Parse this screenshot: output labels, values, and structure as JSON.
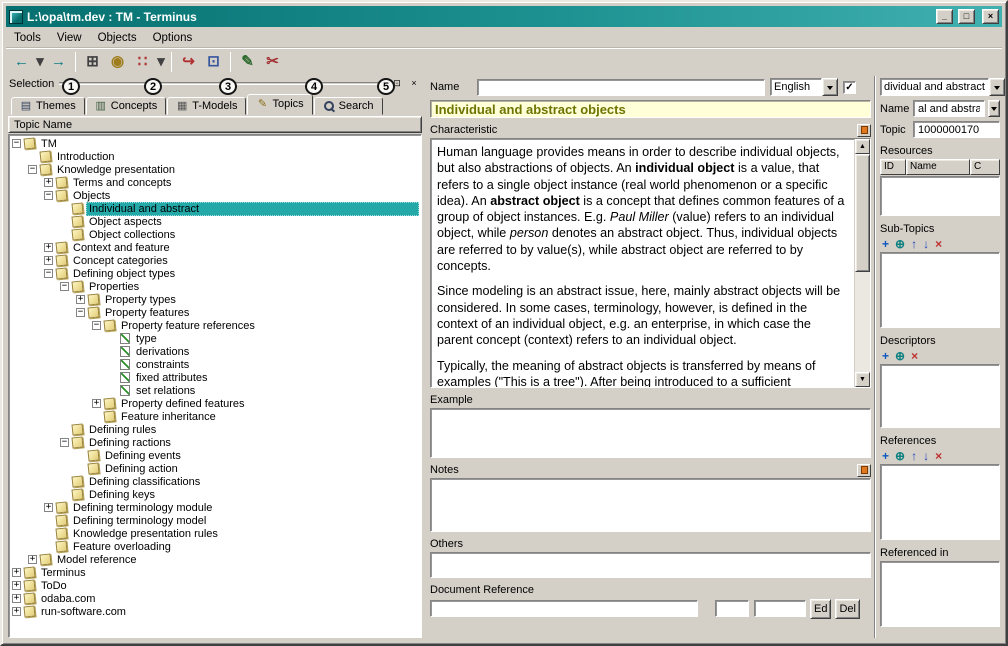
{
  "window": {
    "title": "L:\\opa\\tm.dev : TM - Terminus",
    "controls": [
      {
        "name": "minimize-button",
        "glyph": "_"
      },
      {
        "name": "maximize-button",
        "glyph": "□"
      },
      {
        "name": "close-button",
        "glyph": "×"
      }
    ]
  },
  "colors": {
    "titlebar_teal": "#0a8080",
    "chrome_gray": "#d4d0c8",
    "selection_highlight": "#25a8a8",
    "topic_title_text": "#6e7400",
    "topic_title_bg": "#ffffd8"
  },
  "menu": {
    "items": [
      "Tools",
      "View",
      "Objects",
      "Options"
    ]
  },
  "toolbar": {
    "buttons": [
      {
        "name": "back-button",
        "icon": "back-arrow-icon",
        "glyph": "←",
        "color": "#0e7d86"
      },
      {
        "name": "back-history-button",
        "icon": "chevron-down-icon",
        "glyph": "▾",
        "color": "#404040",
        "narrow": true
      },
      {
        "name": "forward-button",
        "icon": "forward-arrow-icon",
        "glyph": "→",
        "color": "#0e7d86"
      },
      {
        "sep": true
      },
      {
        "name": "hierarchy-view-button",
        "icon": "hierarchy-icon",
        "glyph": "⊞",
        "color": "#404040"
      },
      {
        "name": "theme-view-button",
        "icon": "sphere-icon",
        "glyph": "◉",
        "color": "#a07d1c"
      },
      {
        "name": "new-topic-button",
        "icon": "new-topic-icon",
        "glyph": "∷",
        "color": "#b03434"
      },
      {
        "name": "new-topic-menu-button",
        "icon": "chevron-down-icon",
        "glyph": "▾",
        "color": "#404040",
        "narrow": true
      },
      {
        "sep": true
      },
      {
        "name": "check-out-button",
        "icon": "export-icon",
        "glyph": "↪",
        "color": "#b03030"
      },
      {
        "name": "copy-button",
        "icon": "copy-icon",
        "glyph": "⊡",
        "color": "#35569d"
      },
      {
        "sep": true
      },
      {
        "name": "edit-properties-button",
        "icon": "edit-list-icon",
        "glyph": "✎",
        "color": "#2f6b2f"
      },
      {
        "name": "unlink-button",
        "icon": "cut-icon",
        "glyph": "✂",
        "color": "#a33333"
      }
    ]
  },
  "selection_panel": {
    "caption": "Selection",
    "caption_buttons": [
      {
        "name": "dock-panel-button",
        "glyph": "⊡"
      },
      {
        "name": "close-panel-button",
        "glyph": "×"
      }
    ],
    "annotations": [
      "1",
      "2",
      "3",
      "4",
      "5"
    ],
    "tabs": [
      {
        "label": "Themes",
        "icon": "themes"
      },
      {
        "label": "Concepts",
        "icon": "concepts"
      },
      {
        "label": "T-Models",
        "icon": "tmodels"
      },
      {
        "label": "Topics",
        "icon": "topics",
        "active": true
      },
      {
        "label": "Search",
        "icon": "search"
      }
    ],
    "tree_header": "Topic Name",
    "tree": [
      {
        "label": "TM",
        "depth": 0,
        "expand": "-"
      },
      {
        "label": "Introduction",
        "depth": 1
      },
      {
        "label": "Knowledge presentation",
        "depth": 1,
        "expand": "-"
      },
      {
        "label": "Terms and concepts",
        "depth": 2,
        "expand": "+"
      },
      {
        "label": "Objects",
        "depth": 2,
        "expand": "-"
      },
      {
        "label": "Individual and abstract",
        "depth": 3,
        "selected": true
      },
      {
        "label": "Object aspects",
        "depth": 3
      },
      {
        "label": "Object collections",
        "depth": 3
      },
      {
        "label": "Context and feature",
        "depth": 2,
        "expand": "+"
      },
      {
        "label": "Concept categories",
        "depth": 2,
        "expand": "+"
      },
      {
        "label": "Defining object types",
        "depth": 2,
        "expand": "-"
      },
      {
        "label": "Properties",
        "depth": 3,
        "expand": "-"
      },
      {
        "label": "Property types",
        "depth": 4,
        "expand": "+"
      },
      {
        "label": "Property features",
        "depth": 4,
        "expand": "-"
      },
      {
        "label": "Property feature references",
        "depth": 5,
        "expand": "-"
      },
      {
        "label": "type",
        "depth": 6,
        "icon": "leaf"
      },
      {
        "label": "derivations",
        "depth": 6,
        "icon": "leaf"
      },
      {
        "label": "constraints",
        "depth": 6,
        "icon": "leaf"
      },
      {
        "label": "fixed attributes",
        "depth": 6,
        "icon": "leaf"
      },
      {
        "label": "set relations",
        "depth": 6,
        "icon": "leaf"
      },
      {
        "label": "Property defined features",
        "depth": 5,
        "expand": "+"
      },
      {
        "label": "Feature inheritance",
        "depth": 5
      },
      {
        "label": "Defining rules",
        "depth": 3
      },
      {
        "label": "Defining ractions",
        "depth": 3,
        "expand": "-"
      },
      {
        "label": "Defining events",
        "depth": 4
      },
      {
        "label": "Defining action",
        "depth": 4
      },
      {
        "label": "Defining classifications",
        "depth": 3
      },
      {
        "label": "Defining keys",
        "depth": 3
      },
      {
        "label": "Defining terminology module",
        "depth": 2,
        "expand": "+"
      },
      {
        "label": "Defining terminology model",
        "depth": 2
      },
      {
        "label": "Knowledge presentation rules",
        "depth": 2
      },
      {
        "label": "Feature overloading",
        "depth": 2
      },
      {
        "label": "Model reference",
        "depth": 1,
        "expand": "+"
      },
      {
        "label": "Terminus",
        "depth": 0,
        "expand": "+"
      },
      {
        "label": "ToDo",
        "depth": 0,
        "expand": "+"
      },
      {
        "label": "odaba.com",
        "depth": 0,
        "expand": "+"
      },
      {
        "label": "run-software.com",
        "depth": 0,
        "expand": "+"
      }
    ]
  },
  "editor": {
    "name_label": "Name",
    "name_value": "",
    "language_value": "English",
    "language_check_glyph": "✓",
    "title": "Individual and abstract objects",
    "sections": {
      "characteristic_label": "Characteristic",
      "example_label": "Example",
      "notes_label": "Notes",
      "others_label": "Others",
      "docref_label": "Document Reference"
    },
    "scrollbar": {
      "up": "▲",
      "down": "▼"
    },
    "characteristic_paragraphs": [
      [
        {
          "t": "Human language provides means in order to describe individual objects, but also abstractions of objects. An "
        },
        {
          "t": "individual object",
          "b": true
        },
        {
          "t": " is a value, that refers to a single object instance (real world phenomenon or a specific idea). An "
        },
        {
          "t": "abstract object",
          "b": true
        },
        {
          "t": " is a concept that defines common features of a group of object instances. E.g. "
        },
        {
          "t": "Paul Miller",
          "i": true
        },
        {
          "t": " (value) refers to an individual object, while "
        },
        {
          "t": "person",
          "i": true
        },
        {
          "t": " denotes an abstract object. Thus, individual objects are referred to by value(s), while abstract object are referred to by concepts."
        }
      ],
      [
        {
          "t": "Since modeling is an abstract issue, here, mainly abstract objects will be considered. In some cases, terminology, however, is defined in the context of an individual object, e.g. an enterprise, in which case the parent concept (context) refers to an individual object."
        }
      ],
      [
        {
          "t": "Typically, the meaning of abstract objects is transferred by means of examples (\"This is a tree\"). After being introduced to a sufficient"
        }
      ]
    ],
    "example_value": "",
    "notes_value": "",
    "others_value": "",
    "docref": {
      "main_value": "",
      "field2_value": "",
      "field3_value": "",
      "edit_button": "Ed",
      "delete_button": "Del"
    }
  },
  "sidebar": {
    "topic_combo_value": "dividual and abstract",
    "name_label": "Name",
    "name_value": "al and abstract",
    "topic_label": "Topic",
    "topic_value": "1000000170",
    "resources": {
      "label": "Resources",
      "columns": [
        "ID",
        "Name",
        "C"
      ]
    },
    "sub_topics": {
      "label": "Sub-Topics",
      "toolbar": [
        {
          "name": "insert-subtopic-icon",
          "glyph": "+",
          "color": "#0a58c0"
        },
        {
          "name": "assign-subtopic-icon",
          "glyph": "⊕",
          "color": "#0d8080"
        },
        {
          "name": "subtopic-move-up-icon",
          "glyph": "↑",
          "color": "#2244bb"
        },
        {
          "name": "subtopic-move-down-icon",
          "glyph": "↓",
          "color": "#2244bb"
        },
        {
          "name": "remove-subtopic-icon",
          "glyph": "×",
          "color": "#c03030"
        }
      ]
    },
    "descriptors": {
      "label": "Descriptors",
      "toolbar": [
        {
          "name": "insert-descriptor-icon",
          "glyph": "+",
          "color": "#0a58c0"
        },
        {
          "name": "assign-descriptor-icon",
          "glyph": "⊕",
          "color": "#0d8080"
        },
        {
          "name": "remove-descriptor-icon",
          "glyph": "×",
          "color": "#c03030"
        }
      ]
    },
    "references": {
      "label": "References",
      "toolbar": [
        {
          "name": "insert-reference-icon",
          "glyph": "+",
          "color": "#0a58c0"
        },
        {
          "name": "assign-reference-icon",
          "glyph": "⊕",
          "color": "#0d8080"
        },
        {
          "name": "reference-move-up-icon",
          "glyph": "↑",
          "color": "#2244bb"
        },
        {
          "name": "reference-move-down-icon",
          "glyph": "↓",
          "color": "#2244bb"
        },
        {
          "name": "remove-reference-icon",
          "glyph": "×",
          "color": "#c03030"
        }
      ]
    },
    "referenced_in": {
      "label": "Referenced in"
    }
  }
}
